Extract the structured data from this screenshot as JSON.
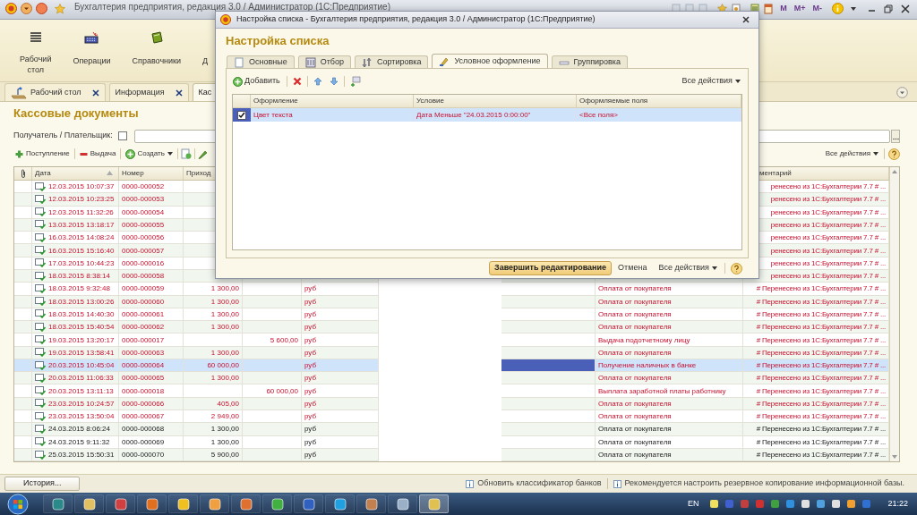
{
  "window": {
    "title": "Бухгалтерия предприятия, редакция 3.0 / Администратор  (1С:Предприятие)",
    "memory_buttons": [
      "M",
      "M+",
      "M-"
    ]
  },
  "sections": [
    {
      "label": "Рабочий стол",
      "kind": "menu"
    },
    {
      "label": "Операции",
      "kind": "operations"
    },
    {
      "label": "Справочники",
      "kind": "book"
    },
    {
      "label": "Д",
      "kind": "hidden"
    }
  ],
  "tabs": [
    {
      "label": "Рабочий стол",
      "kind": "desktop",
      "selected": false
    },
    {
      "label": "Информация",
      "kind": "form",
      "selected": false
    },
    {
      "label": "Кас",
      "kind": "form",
      "selected": true
    }
  ],
  "form": {
    "title": "Кассовые документы",
    "filter": {
      "label": "Получатель / Плательщик:",
      "checked": false
    },
    "toolbar": [
      {
        "label": "Поступление",
        "kind": "plus"
      },
      {
        "label": "Выдача",
        "kind": "minus"
      },
      {
        "label": "Создать",
        "kind": "create"
      },
      {
        "kind": "copy"
      },
      {
        "kind": "edit"
      }
    ],
    "all_actions": "Все действия"
  },
  "table": {
    "columns": [
      "Дата",
      "Номер",
      "Приход"
    ],
    "comment_header": "ментарий",
    "rows": [
      {
        "date": "12.03.2015 10:07:37",
        "number": "0000-000052",
        "comment": "ренесено из 1С:Бухгалтерии 7.7 # ...",
        "highlighted": true,
        "selected": false
      },
      {
        "date": "12.03.2015 10:23:25",
        "number": "0000-000053",
        "comment": "ренесено из 1С:Бухгалтерии 7.7 # ...",
        "highlighted": true,
        "selected": false
      },
      {
        "date": "12.03.2015 11:32:26",
        "number": "0000-000054",
        "comment": "ренесено из 1С:Бухгалтерии 7.7 # ...",
        "highlighted": true,
        "selected": false
      },
      {
        "date": "13.03.2015 13:18:17",
        "number": "0000-000055",
        "comment": "ренесено из 1С:Бухгалтерии 7.7 # ...",
        "highlighted": true,
        "selected": false
      },
      {
        "date": "16.03.2015 14:08:24",
        "number": "0000-000056",
        "comment": "ренесено из 1С:Бухгалтерии 7.7 # ...",
        "highlighted": true,
        "selected": false
      },
      {
        "date": "16.03.2015 15:16:40",
        "number": "0000-000057",
        "comment": "ренесено из 1С:Бухгалтерии 7.7 # ...",
        "highlighted": true,
        "selected": false
      },
      {
        "date": "17.03.2015 10:44:23",
        "number": "0000-000016",
        "comment": "ренесено из 1С:Бухгалтерии 7.7 # ...",
        "highlighted": true,
        "selected": false
      },
      {
        "date": "18.03.2015 8:38:14",
        "number": "0000-000058",
        "comment": "ренесено из 1С:Бухгалтерии 7.7 # ...",
        "highlighted": true,
        "selected": false
      },
      {
        "date": "18.03.2015 9:32:48",
        "number": "0000-000059",
        "income": "1 300,00",
        "currency": "руб",
        "operation": "Оплата от покупателя",
        "comment": "# Перенесено из 1С:Бухгалтерии 7.7 # ...",
        "highlighted": true,
        "selected": false
      },
      {
        "date": "18.03.2015 13:00:26",
        "number": "0000-000060",
        "income": "1 300,00",
        "currency": "руб",
        "operation": "Оплата от покупателя",
        "comment": "# Перенесено из 1С:Бухгалтерии 7.7 # ...",
        "highlighted": true,
        "selected": false
      },
      {
        "date": "18.03.2015 14:40:30",
        "number": "0000-000061",
        "income": "1 300,00",
        "currency": "руб",
        "operation": "Оплата от покупателя",
        "comment": "# Перенесено из 1С:Бухгалтерии 7.7 # ...",
        "highlighted": true,
        "selected": false
      },
      {
        "date": "18.03.2015 15:40:54",
        "number": "0000-000062",
        "income": "1 300,00",
        "currency": "руб",
        "operation": "Оплата от покупателя",
        "comment": "# Перенесено из 1С:Бухгалтерии 7.7 # ...",
        "highlighted": true,
        "selected": false
      },
      {
        "date": "19.03.2015 13:20:17",
        "number": "0000-000017",
        "expense": "5 600,00",
        "currency": "руб",
        "operation": "Выдача подотчетному лицу",
        "comment": "# Перенесено из 1С:Бухгалтерии 7.7 # ...",
        "highlighted": true,
        "selected": false
      },
      {
        "date": "19.03.2015 13:58:41",
        "number": "0000-000063",
        "income": "1 300,00",
        "currency": "руб",
        "operation": "Оплата от покупателя",
        "comment": "# Перенесено из 1С:Бухгалтерии 7.7 # ...",
        "highlighted": true,
        "selected": false
      },
      {
        "date": "20.03.2015 10:45:04",
        "number": "0000-000064",
        "income": "60 000,00",
        "currency": "руб",
        "operation": "Получение наличных в банке",
        "comment": "# Перенесено из 1С:Бухгалтерии 7.7 # ...",
        "highlighted": true,
        "selected": true
      },
      {
        "date": "20.03.2015 11:06:33",
        "number": "0000-000065",
        "income": "1 300,00",
        "currency": "руб",
        "operation": "Оплата от покупателя",
        "comment": "# Перенесено из 1С:Бухгалтерии 7.7 # ...",
        "highlighted": true,
        "selected": false
      },
      {
        "date": "20.03.2015 13:11:13",
        "number": "0000-000018",
        "expense": "60 000,00",
        "currency": "руб",
        "operation": "Выплата заработной платы работнику",
        "comment": "# Перенесено из 1С:Бухгалтерии 7.7 # ...",
        "highlighted": true,
        "selected": false
      },
      {
        "date": "23.03.2015 10:24:57",
        "number": "0000-000066",
        "income": "405,00",
        "currency": "руб",
        "operation": "Оплата от покупателя",
        "comment": "# Перенесено из 1С:Бухгалтерии 7.7 # ...",
        "highlighted": true,
        "selected": false
      },
      {
        "date": "23.03.2015 13:50:04",
        "number": "0000-000067",
        "income": "2 949,00",
        "currency": "руб",
        "operation": "Оплата от покупателя",
        "comment": "# Перенесено из 1С:Бухгалтерии 7.7 # ...",
        "highlighted": true,
        "selected": false
      },
      {
        "date": "24.03.2015 8:06:24",
        "number": "0000-000068",
        "income": "1 300,00",
        "currency": "руб",
        "operation": "Оплата от покупателя",
        "comment": "# Перенесено из 1С:Бухгалтерии 7.7 # ...",
        "highlighted": false,
        "selected": false
      },
      {
        "date": "24.03.2015 9:11:32",
        "number": "0000-000069",
        "income": "1 300,00",
        "currency": "руб",
        "operation": "Оплата от покупателя",
        "comment": "# Перенесено из 1С:Бухгалтерии 7.7 # ...",
        "highlighted": false,
        "selected": false
      },
      {
        "date": "25.03.2015 15:50:31",
        "number": "0000-000070",
        "income": "5 900,00",
        "currency": "руб",
        "operation": "Оплата от покупателя",
        "comment": "# Перенесено из 1С:Бухгалтерии 7.7 # ...",
        "highlighted": false,
        "selected": false
      }
    ]
  },
  "dialog": {
    "title": "Настройка списка - Бухгалтерия предприятия, редакция 3.0 / Администратор  (1С:Предприятие)",
    "heading": "Настройка списка",
    "tabs": [
      {
        "label": "Основные",
        "kind": "general",
        "selected": false
      },
      {
        "label": "Отбор",
        "kind": "filter",
        "selected": false
      },
      {
        "label": "Сортировка",
        "kind": "sort",
        "selected": false
      },
      {
        "label": "Условное оформление",
        "kind": "appearance",
        "selected": true
      },
      {
        "label": "Группировка",
        "kind": "grouping",
        "selected": false
      }
    ],
    "add": "Добавить",
    "all_actions": "Все действия",
    "table": {
      "columns": [
        "Оформление",
        "Условие",
        "Оформляемые поля"
      ],
      "rows": [
        {
          "checked": true,
          "selected": true,
          "appearance": "Цвет текста",
          "condition": "Дата Меньше \"24.03.2015 0:00:00\"",
          "fields": "<Все поля>"
        }
      ]
    },
    "finish": "Завершить редактирование",
    "cancel": "Отмена",
    "footer_actions": "Все действия"
  },
  "status": {
    "history": "История...",
    "notifications": [
      "Обновить классификатор банков",
      "Рекомендуется настроить резервное копирование информационной базы."
    ]
  },
  "taskbar": {
    "language": "EN",
    "clock": "21:22"
  }
}
